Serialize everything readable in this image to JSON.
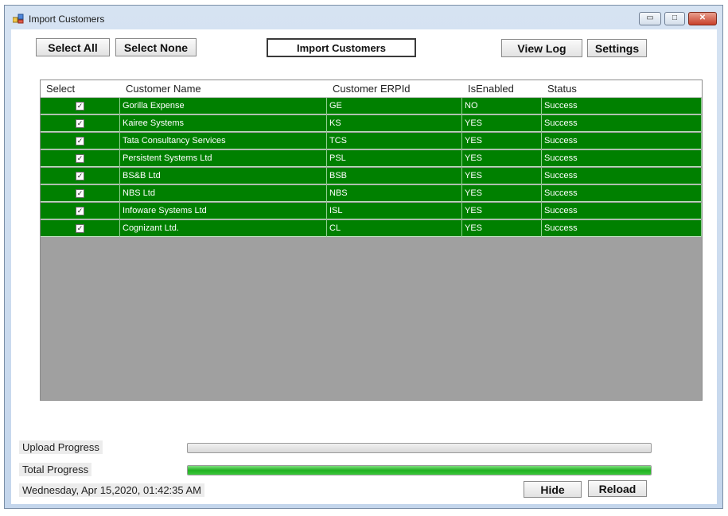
{
  "window": {
    "title": "Import Customers",
    "minimize_label": "▭",
    "maximize_label": "□",
    "close_label": "✕"
  },
  "toolbar": {
    "select_all": "Select All",
    "select_none": "Select None",
    "import_customers": "Import Customers",
    "view_log": "View Log",
    "settings": "Settings"
  },
  "grid": {
    "columns": [
      "Select",
      "Customer Name",
      "Customer ERPId",
      "IsEnabled",
      "Status"
    ],
    "rows": [
      {
        "selected": true,
        "name": "Gorilla Expense",
        "erpid": "GE",
        "enabled": "NO",
        "status": "Success"
      },
      {
        "selected": true,
        "name": "Kairee Systems",
        "erpid": "KS",
        "enabled": "YES",
        "status": "Success"
      },
      {
        "selected": true,
        "name": "Tata Consultancy Services",
        "erpid": "TCS",
        "enabled": "YES",
        "status": "Success"
      },
      {
        "selected": true,
        "name": "Persistent Systems Ltd",
        "erpid": "PSL",
        "enabled": "YES",
        "status": "Success"
      },
      {
        "selected": true,
        "name": "BS&B Ltd",
        "erpid": "BSB",
        "enabled": "YES",
        "status": "Success"
      },
      {
        "selected": true,
        "name": "NBS Ltd",
        "erpid": "NBS",
        "enabled": "YES",
        "status": "Success"
      },
      {
        "selected": true,
        "name": "Infoware Systems Ltd",
        "erpid": "ISL",
        "enabled": "YES",
        "status": "Success"
      },
      {
        "selected": true,
        "name": "Cognizant Ltd.",
        "erpid": "CL",
        "enabled": "YES",
        "status": "Success"
      }
    ],
    "row_color": "#008000",
    "empty_area_color": "#a0a0a0"
  },
  "progress": {
    "upload_label": "Upload Progress",
    "upload_value": 0,
    "total_label": "Total Progress",
    "total_value": 1.0
  },
  "footer": {
    "timestamp": "Wednesday, Apr 15,2020, 01:42:35 AM",
    "hide": "Hide",
    "reload": "Reload"
  },
  "icons": {
    "app": "app-window-icon",
    "check": "checkmark-icon"
  }
}
